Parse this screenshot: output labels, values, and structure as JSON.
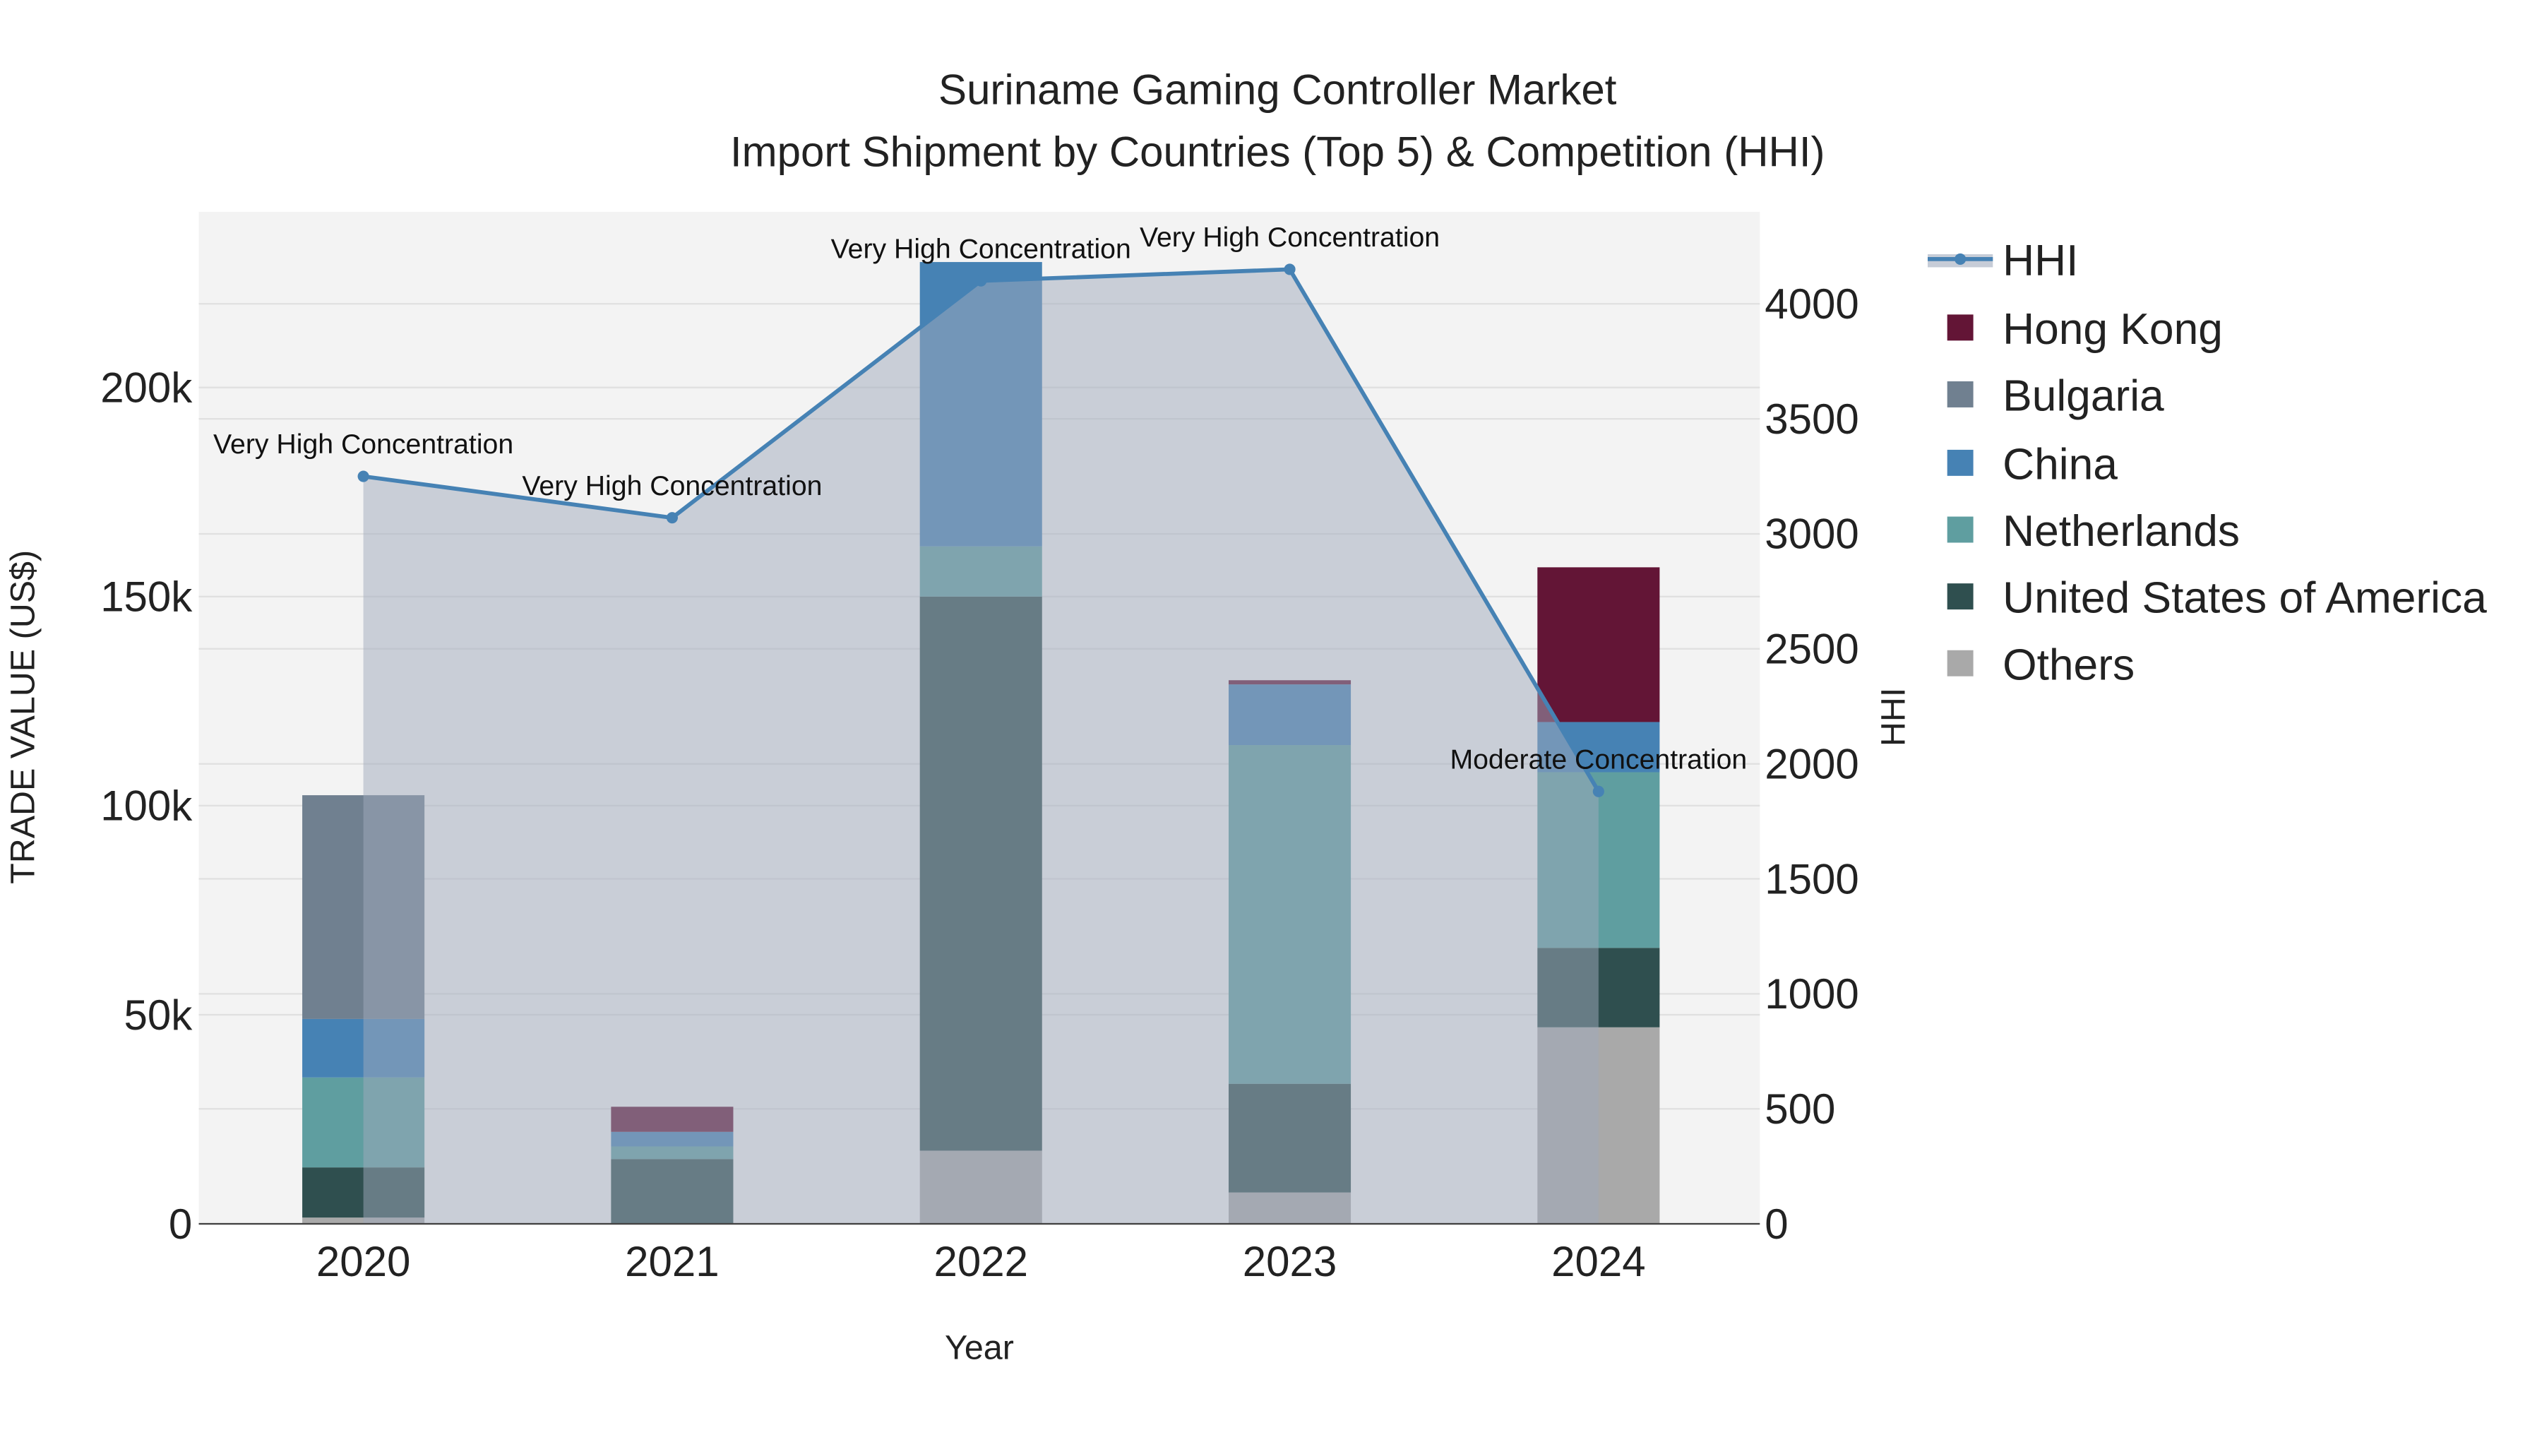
{
  "chart_data": {
    "type": "bar",
    "title": "Suriname Gaming Controller Market",
    "subtitle": "Import Shipment by Countries (Top 5) & Competition (HHI)",
    "xlabel": "Year",
    "ylabel": "TRADE VALUE (US$)",
    "y2label": "HHI",
    "categories": [
      "2020",
      "2021",
      "2022",
      "2023",
      "2024"
    ],
    "ylim": [
      0,
      242000
    ],
    "y2lim": [
      0,
      4400
    ],
    "yticks": [
      0,
      50000,
      100000,
      150000,
      200000
    ],
    "ytick_labels": [
      "0",
      "50k",
      "100k",
      "150k",
      "200k"
    ],
    "y2ticks": [
      0,
      500,
      1000,
      1500,
      2000,
      2500,
      3000,
      3500,
      4000
    ],
    "y2tick_labels": [
      "0",
      "500",
      "1000",
      "1500",
      "2000",
      "2500",
      "3000",
      "3500",
      "4000"
    ],
    "stacked": true,
    "series": [
      {
        "name": "Others",
        "color": "#a9a9a9",
        "values": [
          1500,
          0,
          17500,
          7500,
          47000
        ]
      },
      {
        "name": "United States of America",
        "color": "#2f4f4f",
        "values": [
          12000,
          15500,
          132500,
          26000,
          19000
        ]
      },
      {
        "name": "Netherlands",
        "color": "#5f9ea0",
        "values": [
          21500,
          3000,
          12000,
          81000,
          42000
        ]
      },
      {
        "name": "China",
        "color": "#4682b4",
        "values": [
          14000,
          3500,
          68000,
          14500,
          12000
        ]
      },
      {
        "name": "Bulgaria",
        "color": "#708090",
        "values": [
          53500,
          0,
          0,
          0,
          0
        ]
      },
      {
        "name": "Hong Kong",
        "color": "#631536",
        "values": [
          0,
          6000,
          0,
          1000,
          37000
        ]
      }
    ],
    "hhi": {
      "name": "HHI",
      "color": "#4682b4",
      "values": [
        3250,
        3070,
        4100,
        4150,
        1880
      ],
      "annotations": [
        "Very High Concentration",
        "Very High Concentration",
        "Very High Concentration",
        "Very High Concentration",
        "Moderate Concentration"
      ]
    },
    "legend": {
      "placement": "right",
      "entries": [
        "HHI",
        "Hong Kong",
        "Bulgaria",
        "China",
        "Netherlands",
        "United States of America",
        "Others"
      ]
    },
    "grid": true
  }
}
